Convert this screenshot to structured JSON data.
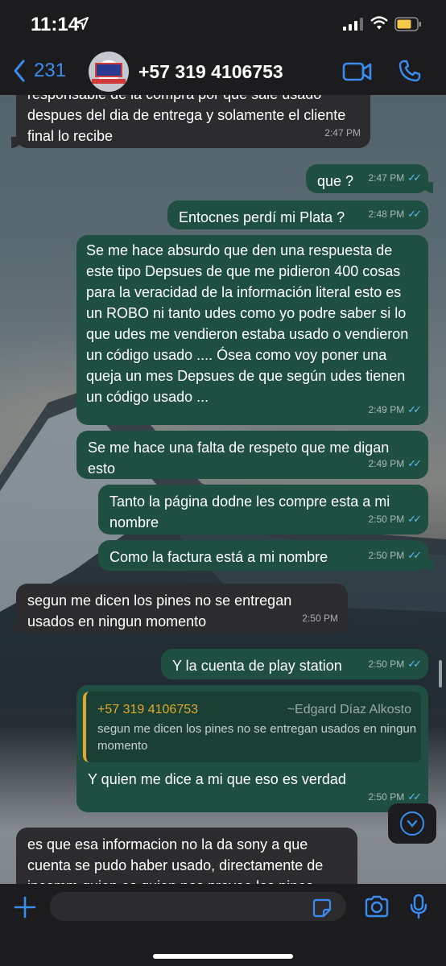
{
  "status": {
    "time": "11:14"
  },
  "header": {
    "back_count": "231",
    "contact": "+57 319 4106753"
  },
  "messages": [
    {
      "dir": "in",
      "text": "responsable de la compra por que sale usado despues del dia de entrega y solamente el cliente final lo recibe",
      "time": "2:47 PM"
    },
    {
      "dir": "out",
      "text": "que ?",
      "time": "2:47 PM"
    },
    {
      "dir": "out",
      "text": "Entocnes perdí mi Plata ?",
      "time": "2:48 PM"
    },
    {
      "dir": "out",
      "text": "Se me hace absurdo que den una respuesta de este tipo Depsues de que me pidieron 400 cosas para la veracidad de la información literal esto es un ROBO  ni tanto udes como yo podre saber si lo que udes me vendieron estaba usado o vendieron un código usado .... Ósea como voy poner una queja un mes Depsues de que según udes tienen un código usado ...",
      "time": "2:49 PM"
    },
    {
      "dir": "out",
      "text": "Se me hace una falta de respeto que me digan esto",
      "time": "2:49 PM"
    },
    {
      "dir": "out",
      "text": "Tanto la página dodne les compre esta a mi nombre",
      "time": "2:50 PM"
    },
    {
      "dir": "out",
      "text": "Como la factura está a mi nombre",
      "time": "2:50 PM"
    },
    {
      "dir": "in",
      "text": "segun me dicen los pines no se entregan usados en ningun momento",
      "time": "2:50 PM"
    },
    {
      "dir": "out",
      "text": "Y la cuenta de play station",
      "time": "2:50 PM"
    },
    {
      "dir": "out",
      "text": "Y  quien me dice a mi que eso es verdad",
      "time": "2:50 PM",
      "quote": {
        "number": "+57 319 4106753",
        "name": "~Edgard Díaz Alkosto",
        "text": "segun me dicen los pines no se entregan usados en ningun momento"
      }
    },
    {
      "dir": "in",
      "text": "es que esa informacion no la da sony a que cuenta se pudo haber usado, directamente de incomm quien es quien nos provee los pines",
      "time": ""
    }
  ],
  "icons": [
    "location-arrow-icon",
    "signal-icon",
    "wifi-icon",
    "battery-icon",
    "back-chevron-icon",
    "video-call-icon",
    "phone-icon",
    "read-ticks-icon",
    "scroll-down-icon",
    "plus-icon",
    "sticker-icon",
    "camera-icon",
    "microphone-icon"
  ],
  "colors": {
    "outgoing": "#1f4f41",
    "incoming": "#2c2c2e",
    "accent": "#3a8cf0",
    "ticks": "#53bdeb",
    "quote_bar": "#e0a92c"
  }
}
